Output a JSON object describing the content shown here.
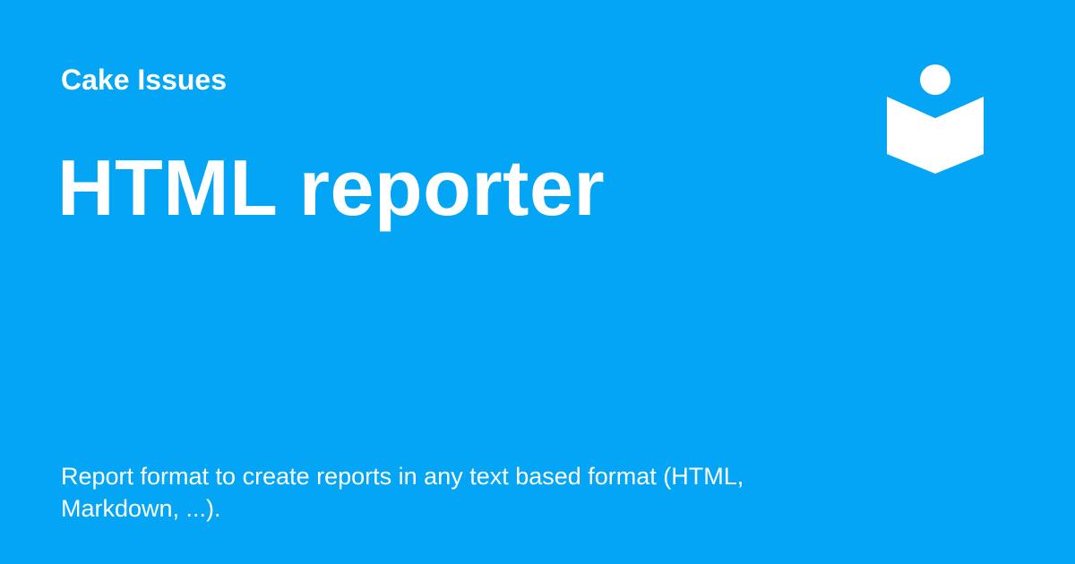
{
  "site": {
    "name": "Cake Issues"
  },
  "page": {
    "title": "HTML reporter",
    "description": "Report format to create reports in any text based format (HTML, Markdown, ...)."
  },
  "logo": {
    "icon": "reader-book-icon"
  },
  "colors": {
    "background": "#03a5f4",
    "text": "#ffffff"
  }
}
